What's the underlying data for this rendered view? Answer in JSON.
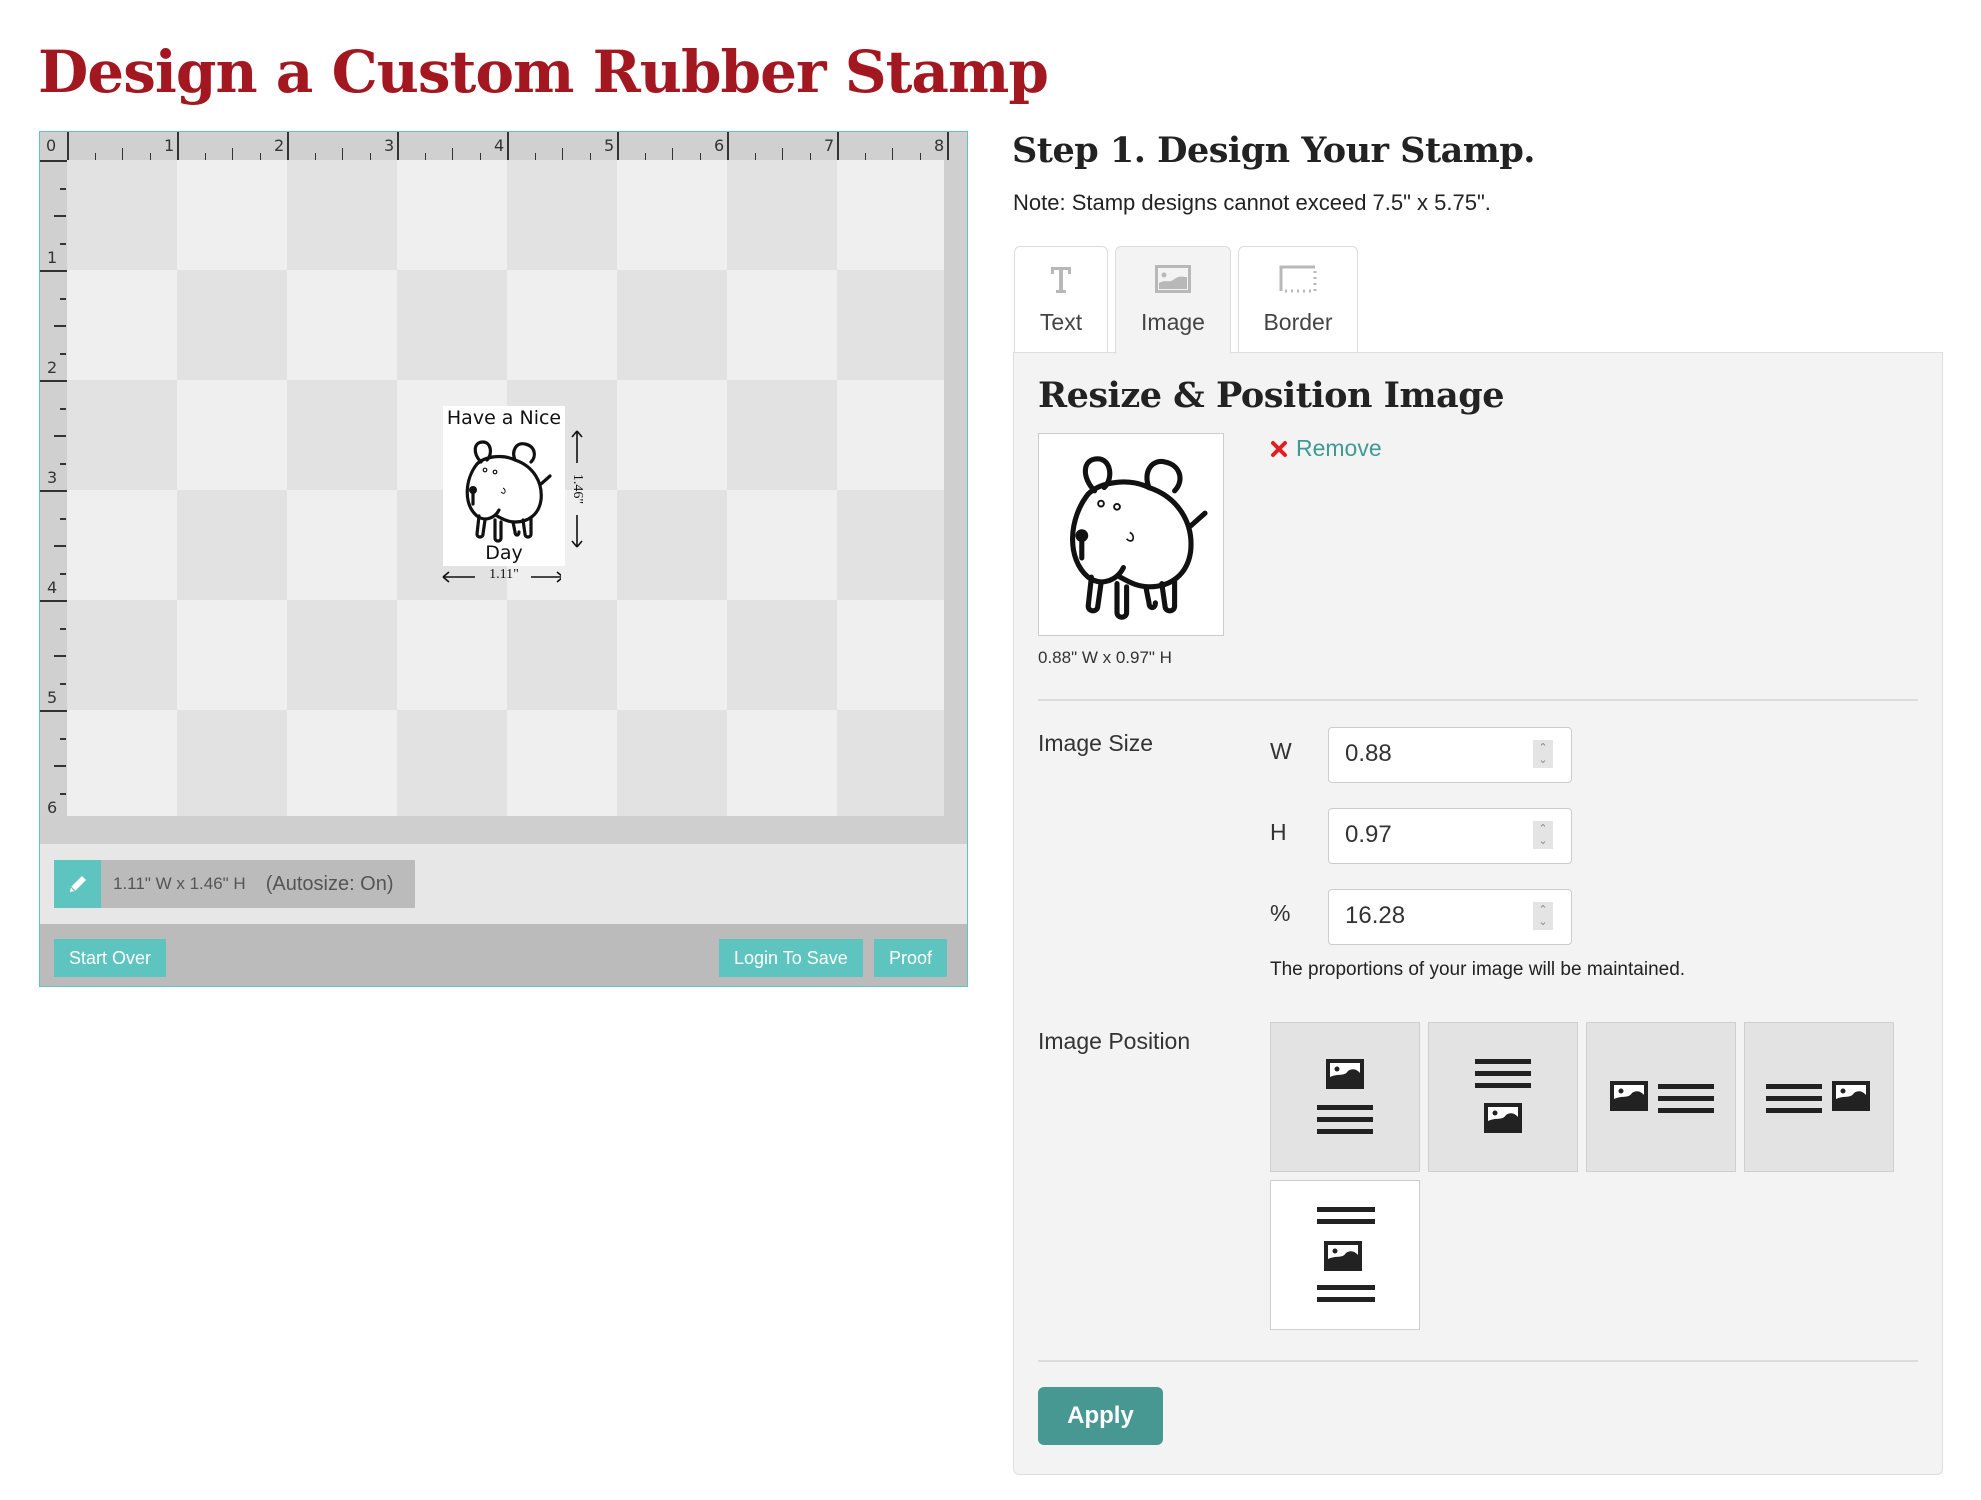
{
  "page": {
    "title": "Design a Custom Rubber Stamp"
  },
  "designer": {
    "ruler": {
      "unit": "inch",
      "top_labels": [
        "0",
        "1",
        "2",
        "3",
        "4",
        "5",
        "6",
        "7",
        "8"
      ],
      "left_labels": [
        "1",
        "2",
        "3",
        "4",
        "5",
        "6"
      ]
    },
    "stamp": {
      "text_line_1": "Have a Nice",
      "text_line_2": "Day",
      "image": "dog-icon",
      "width_label": "1.11\"",
      "height_label": "1.46\""
    },
    "dimension_bar": {
      "edit_icon": "pencil-icon",
      "size_text": "1.11\" W x 1.46\" H",
      "autosize_text": "(Autosize: On)"
    },
    "footer": {
      "start_over": "Start Over",
      "login_to_save": "Login To Save",
      "proof": "Proof"
    }
  },
  "step": {
    "title": "Step 1. Design Your Stamp.",
    "note": "Note: Stamp designs cannot exceed 7.5\" x 5.75\"."
  },
  "tabs": [
    {
      "label": "Text",
      "icon": "text-icon",
      "active": false
    },
    {
      "label": "Image",
      "icon": "image-icon",
      "active": true
    },
    {
      "label": "Border",
      "icon": "border-icon",
      "active": false
    }
  ],
  "panel": {
    "title": "Resize & Position Image",
    "thumbnail_size": "0.88\" W x 0.97\" H",
    "remove_label": "Remove",
    "image_size_label": "Image Size",
    "fields": {
      "w_label": "W",
      "w_value": "0.88",
      "h_label": "H",
      "h_value": "0.97",
      "pct_label": "%",
      "pct_value": "16.28"
    },
    "proportion_note": "The proportions of your image will be maintained.",
    "image_position_label": "Image Position",
    "positions": [
      {
        "name": "image-above-text",
        "selected": false
      },
      {
        "name": "image-below-text",
        "selected": false
      },
      {
        "name": "image-left-of-text",
        "selected": false
      },
      {
        "name": "image-right-of-text",
        "selected": false
      },
      {
        "name": "image-between-text",
        "selected": true
      }
    ],
    "apply_label": "Apply"
  },
  "colors": {
    "title_red": "#a31820",
    "teal": "#5ec4c0",
    "apply_teal": "#479793",
    "remove_red": "#e02020",
    "link_teal": "#3e9a94"
  }
}
